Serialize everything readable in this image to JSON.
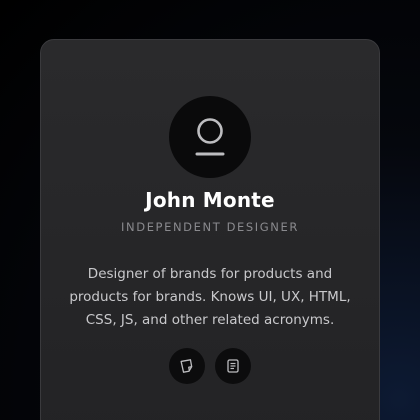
{
  "profile": {
    "name": "John Monte",
    "role": "INDEPENDENT DESIGNER",
    "bio": "Designer of brands for products and products for brands. Knows UI, UX, HTML, CSS, JS, and other related acronyms.",
    "avatar_icon": "user-icon"
  },
  "social": [
    {
      "icon": "note-icon"
    },
    {
      "icon": "document-icon"
    }
  ],
  "colors": {
    "card_bg": "#262628",
    "avatar_bg": "#0a0a0b",
    "name": "#ffffff",
    "role": "#8a8a8e",
    "bio": "#c9c9cc"
  }
}
